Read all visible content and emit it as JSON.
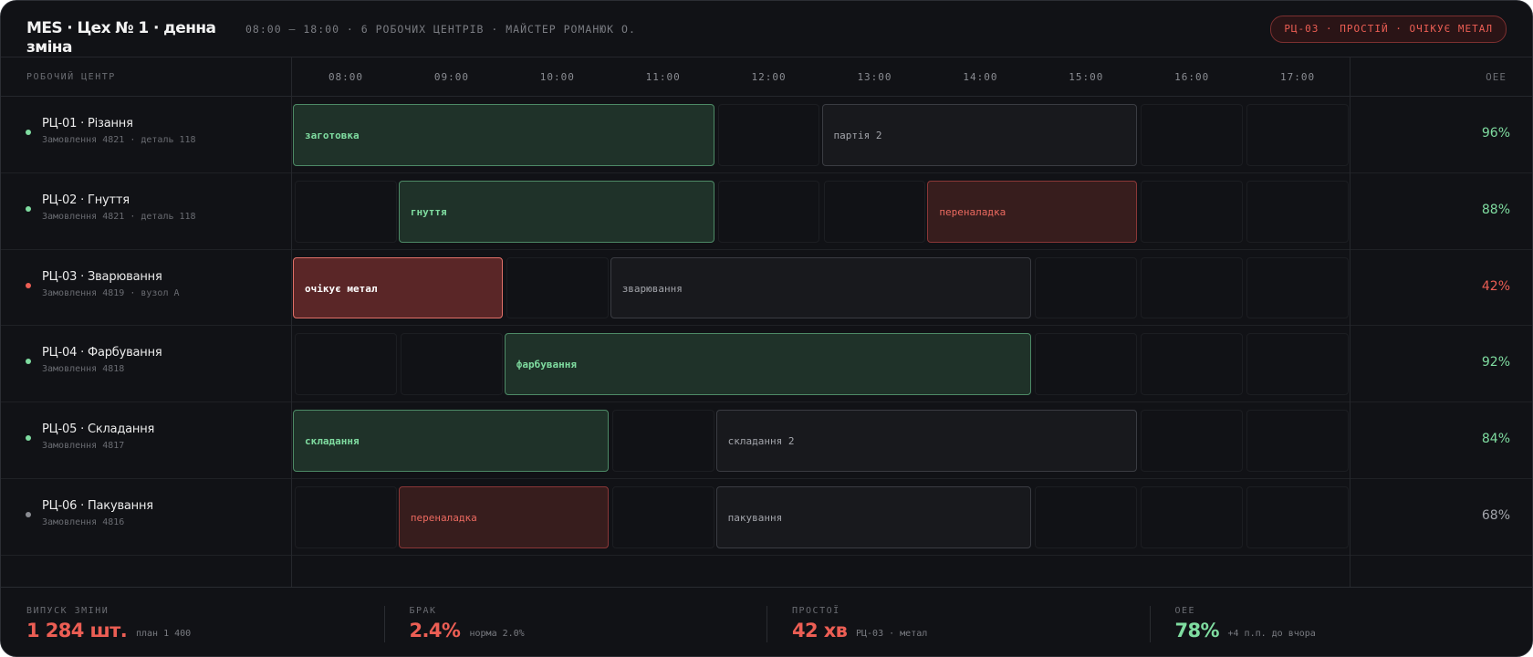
{
  "header": {
    "title": "MES · Цех № 1 · денна зміна",
    "meta": "08:00 — 18:00 · 6 робочих центрів · майстер Романюк О.",
    "alert": "РЦ-03 · простій · очікує метал"
  },
  "columns": {
    "work_center": "Робочий центр",
    "hours": [
      "08:00",
      "09:00",
      "10:00",
      "11:00",
      "12:00",
      "13:00",
      "14:00",
      "15:00",
      "16:00",
      "17:00"
    ],
    "oee": "OEE"
  },
  "colors": {
    "ok": "#7fdca0",
    "warn": "#ec5e54",
    "neutral": "#a3a5ab",
    "status_ok": "#7fdca0",
    "status_down": "#ec5e54",
    "status_idle": "#8a8c92"
  },
  "work_centers": [
    {
      "name": "РЦ-01 · Різання",
      "order": "Замовлення 4821 · деталь 118",
      "status": "status_ok",
      "oee": "96%",
      "oee_color": "ok",
      "tasks": [
        {
          "label": "заготовка",
          "kind": "ok",
          "start": 8,
          "end": 12
        },
        {
          "label": "партія 2",
          "kind": "plan",
          "start": 13,
          "end": 16
        }
      ]
    },
    {
      "name": "РЦ-02 · Гнуття",
      "order": "Замовлення 4821 · деталь 118",
      "status": "status_ok",
      "oee": "88%",
      "oee_color": "ok",
      "tasks": [
        {
          "label": "гнуття",
          "kind": "ok",
          "start": 9,
          "end": 12
        },
        {
          "label": "переналадка",
          "kind": "setup",
          "start": 14,
          "end": 16
        }
      ]
    },
    {
      "name": "РЦ-03 · Зварювання",
      "order": "Замовлення 4819 · вузол А",
      "status": "status_down",
      "oee": "42%",
      "oee_color": "warn",
      "tasks": [
        {
          "label": "очікує метал",
          "kind": "down",
          "start": 8,
          "end": 10
        },
        {
          "label": "зварювання",
          "kind": "plan",
          "start": 11,
          "end": 15
        }
      ]
    },
    {
      "name": "РЦ-04 · Фарбування",
      "order": "Замовлення 4818",
      "status": "status_ok",
      "oee": "92%",
      "oee_color": "ok",
      "tasks": [
        {
          "label": "фарбування",
          "kind": "ok",
          "start": 10,
          "end": 15
        }
      ]
    },
    {
      "name": "РЦ-05 · Складання",
      "order": "Замовлення 4817",
      "status": "status_ok",
      "oee": "84%",
      "oee_color": "ok",
      "tasks": [
        {
          "label": "складання",
          "kind": "ok",
          "start": 8,
          "end": 11
        },
        {
          "label": "складання 2",
          "kind": "plan",
          "start": 12,
          "end": 16
        }
      ]
    },
    {
      "name": "РЦ-06 · Пакування",
      "order": "Замовлення 4816",
      "status": "status_idle",
      "oee": "68%",
      "oee_color": "neutral",
      "tasks": [
        {
          "label": "переналадка",
          "kind": "setup",
          "start": 9,
          "end": 11
        },
        {
          "label": "пакування",
          "kind": "plan",
          "start": 12,
          "end": 15
        }
      ]
    }
  ],
  "footer": [
    {
      "label": "Випуск зміни",
      "value": "1 284 шт.",
      "note": "план 1 400",
      "color": "warn"
    },
    {
      "label": "Брак",
      "value": "2.4%",
      "note": "норма 2.0%",
      "color": "warn"
    },
    {
      "label": "Простої",
      "value": "42 хв",
      "note": "РЦ-03 · метал",
      "color": "warn"
    },
    {
      "label": "OEE",
      "value": "78%",
      "note": "+4 п.п. до вчора",
      "color": "ok"
    }
  ]
}
